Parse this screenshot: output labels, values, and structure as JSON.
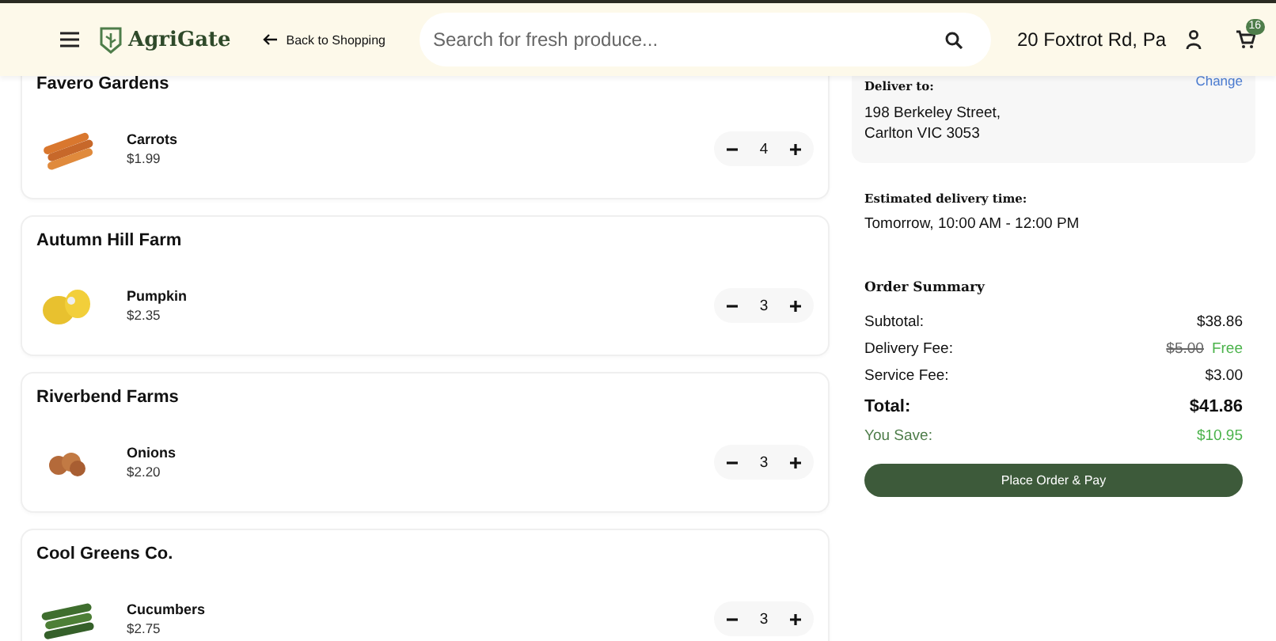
{
  "header": {
    "brand": "AgriGate",
    "back_link": "Back to Shopping",
    "search": {
      "placeholder": "Search for fresh produce..."
    },
    "location": "20 Foxtrot Rd, Pa",
    "cart_count": "16"
  },
  "vendors": [
    {
      "name": "Favero Gardens",
      "items": [
        {
          "name": "Carrots",
          "price": "$1.99",
          "quantity": "4",
          "kind": "carrot"
        }
      ]
    },
    {
      "name": "Autumn Hill Farm",
      "items": [
        {
          "name": "Pumpkin",
          "price": "$2.35",
          "quantity": "3",
          "kind": "pumpkin"
        }
      ]
    },
    {
      "name": "Riverbend Farms",
      "items": [
        {
          "name": "Onions",
          "price": "$2.20",
          "quantity": "3",
          "kind": "onion"
        }
      ]
    },
    {
      "name": "Cool Greens Co.",
      "items": [
        {
          "name": "Cucumbers",
          "price": "$2.75",
          "quantity": "3",
          "kind": "cucumber"
        }
      ]
    }
  ],
  "delivery": {
    "label": "Deliver to:",
    "change_link": "Change",
    "address_lines": [
      "198 Berkeley Street,",
      "Carlton VIC 3053"
    ]
  },
  "estimate": {
    "label": "Estimated delivery time:",
    "value": "Tomorrow, 10:00 AM - 12:00 PM"
  },
  "summary": {
    "title": "Order Summary",
    "rows": [
      {
        "label": "Subtotal:",
        "value": "$38.86",
        "kind": "normal"
      },
      {
        "label": "Delivery Fee:",
        "original": "$5.00",
        "value": "Free",
        "kind": "discounted"
      },
      {
        "label": "Service Fee:",
        "value": "$3.00",
        "kind": "normal"
      },
      {
        "label": "Total:",
        "value": "$41.86",
        "kind": "total"
      },
      {
        "label": "You Save:",
        "value": "$10.95",
        "kind": "saving"
      }
    ]
  },
  "button": "Place Order & Pay"
}
